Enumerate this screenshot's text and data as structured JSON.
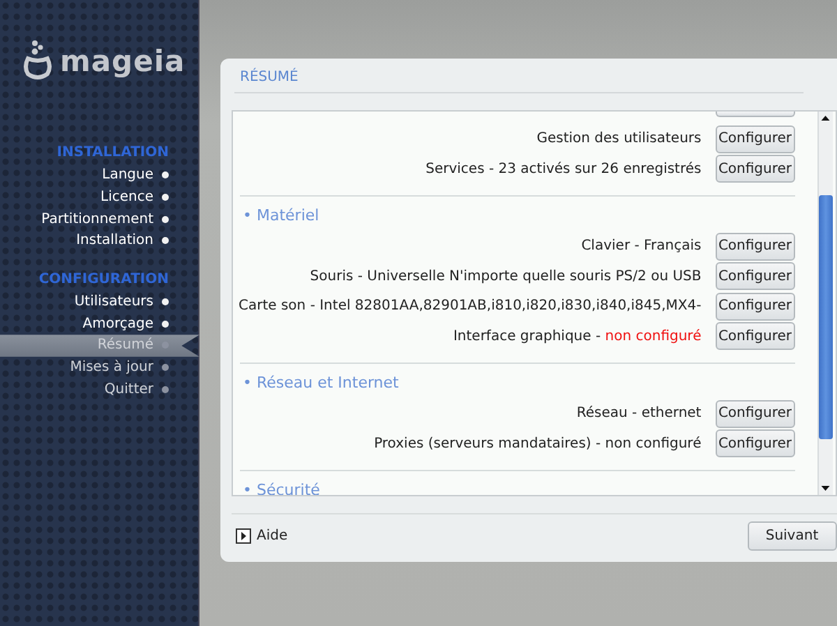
{
  "sidebar": {
    "logo": "mageia",
    "groups": [
      {
        "heading": "INSTALLATION",
        "items": [
          {
            "label": "Langue",
            "completed": true,
            "selected": false
          },
          {
            "label": "Licence",
            "completed": true,
            "selected": false
          },
          {
            "label": "Partitionnement",
            "completed": true,
            "selected": false
          },
          {
            "label": "Installation",
            "completed": true,
            "selected": false
          }
        ]
      },
      {
        "heading": "CONFIGURATION",
        "items": [
          {
            "label": "Utilisateurs",
            "completed": true,
            "selected": false
          },
          {
            "label": "Amorçage",
            "completed": true,
            "selected": false
          },
          {
            "label": "Résumé",
            "completed": false,
            "selected": true
          },
          {
            "label": "Mises à jour",
            "completed": false,
            "selected": false
          },
          {
            "label": "Quitter",
            "completed": false,
            "selected": false
          }
        ]
      }
    ]
  },
  "panel": {
    "title": "RÉSUMÉ",
    "sections": [
      {
        "rows": [
          {
            "label": "Gestion des utilisateurs",
            "button": "Configurer"
          },
          {
            "label": "Services - 23 activés sur 26 enregistrés",
            "button": "Configurer"
          }
        ]
      },
      {
        "heading": "• Matériel",
        "rows": [
          {
            "label": "Clavier - Français",
            "button": "Configurer"
          },
          {
            "label": "Souris - Universelle N'importe quelle souris PS/2 ou USB",
            "button": "Configurer"
          },
          {
            "label": "Carte son - Intel 82801AA,82901AB,i810,i820,i830,i840,i845,MX4-",
            "button": "Configurer"
          },
          {
            "label": "Interface graphique - ",
            "alert": "non configuré",
            "button": "Configurer"
          }
        ]
      },
      {
        "heading": "• Réseau et Internet",
        "rows": [
          {
            "label": "Réseau - ethernet",
            "button": "Configurer"
          },
          {
            "label": "Proxies (serveurs mandataires) - non configuré",
            "button": "Configurer"
          }
        ]
      },
      {
        "heading": "• Sécurité"
      }
    ],
    "help": "Aide",
    "next": "Suivant"
  }
}
